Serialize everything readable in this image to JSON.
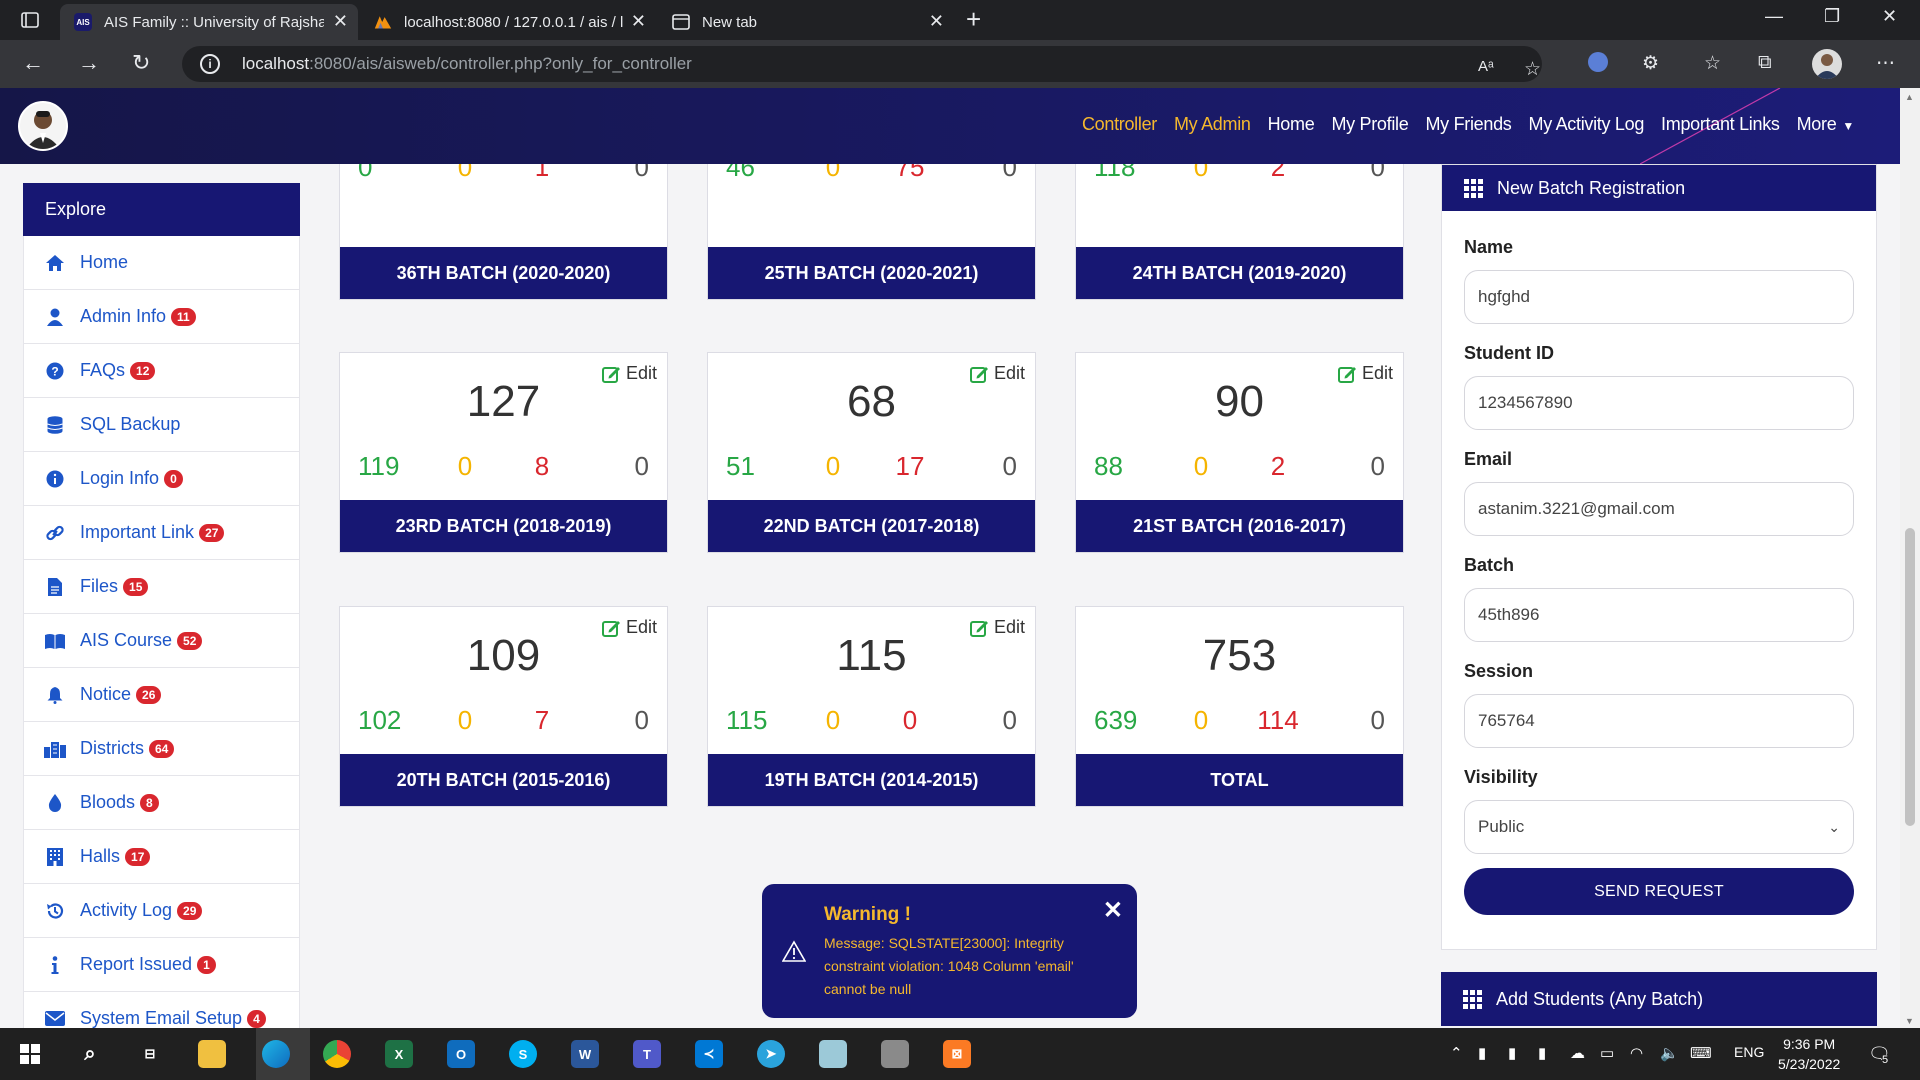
{
  "browser": {
    "tabs": [
      {
        "title": "AIS Family :: University of Rajshah",
        "favicon": "AIS",
        "active": true
      },
      {
        "title": "localhost:8080 / 127.0.0.1 / ais / l",
        "favicon": "pma",
        "active": false
      },
      {
        "title": "New tab",
        "favicon": "new-tab",
        "active": false
      }
    ],
    "url_host": "localhost",
    "url_rest": ":8080/ais/aisweb/controller.php?only_for_controller",
    "read_aloud": "Aᵃ"
  },
  "navbar": {
    "links": [
      "Controller",
      "My Admin",
      "Home",
      "My Profile",
      "My Friends",
      "My Activity Log",
      "Important Links",
      "More"
    ],
    "highlight_color": "#f5b82e",
    "background": "#171773"
  },
  "sidebar": {
    "title": "Explore",
    "items": [
      {
        "label": "Home",
        "icon": "home-icon",
        "badge": ""
      },
      {
        "label": "Admin Info",
        "icon": "user-icon",
        "badge": "11"
      },
      {
        "label": "FAQs",
        "icon": "question-circle-icon",
        "badge": "12"
      },
      {
        "label": "SQL Backup",
        "icon": "database-icon",
        "badge": ""
      },
      {
        "label": "Login Info",
        "icon": "info-circle-icon",
        "badge": "0"
      },
      {
        "label": "Important Link",
        "icon": "link-icon",
        "badge": "27"
      },
      {
        "label": "Files",
        "icon": "file-icon",
        "badge": "15"
      },
      {
        "label": "AIS Course",
        "icon": "book-open-icon",
        "badge": "52"
      },
      {
        "label": "Notice",
        "icon": "bell-icon",
        "badge": "26"
      },
      {
        "label": "Districts",
        "icon": "city-icon",
        "badge": "64"
      },
      {
        "label": "Bloods",
        "icon": "tint-icon",
        "badge": "8"
      },
      {
        "label": "Halls",
        "icon": "building-icon",
        "badge": "17"
      },
      {
        "label": "Activity Log",
        "icon": "history-icon",
        "badge": "29"
      },
      {
        "label": "Report Issued",
        "icon": "info-icon",
        "badge": "1"
      },
      {
        "label": "System Email Setup",
        "icon": "envelope-icon",
        "badge": "4"
      }
    ]
  },
  "batches": {
    "edit_label": "Edit",
    "cards": [
      {
        "name": "36TH BATCH (2020-2020)",
        "total": "",
        "stats": [
          "0",
          "0",
          "1",
          "0"
        ],
        "editable": false
      },
      {
        "name": "25TH BATCH (2020-2021)",
        "total": "",
        "stats": [
          "46",
          "0",
          "75",
          "0"
        ],
        "editable": false
      },
      {
        "name": "24TH BATCH (2019-2020)",
        "total": "",
        "stats": [
          "118",
          "0",
          "2",
          "0"
        ],
        "editable": false
      },
      {
        "name": "23RD BATCH (2018-2019)",
        "total": "127",
        "stats": [
          "119",
          "0",
          "8",
          "0"
        ],
        "editable": true
      },
      {
        "name": "22ND BATCH (2017-2018)",
        "total": "68",
        "stats": [
          "51",
          "0",
          "17",
          "0"
        ],
        "editable": true
      },
      {
        "name": "21ST BATCH (2016-2017)",
        "total": "90",
        "stats": [
          "88",
          "0",
          "2",
          "0"
        ],
        "editable": true
      },
      {
        "name": "20TH BATCH (2015-2016)",
        "total": "109",
        "stats": [
          "102",
          "0",
          "7",
          "0"
        ],
        "editable": true
      },
      {
        "name": "19TH BATCH (2014-2015)",
        "total": "115",
        "stats": [
          "115",
          "0",
          "0",
          "0"
        ],
        "editable": true
      },
      {
        "name": "TOTAL",
        "total": "753",
        "stats": [
          "639",
          "0",
          "114",
          "0"
        ],
        "editable": false
      }
    ],
    "stat_colors": [
      "#28a745",
      "#f5b400",
      "#d9272e",
      "#555555"
    ]
  },
  "new_batch_form": {
    "title": "New Batch Registration",
    "fields": [
      {
        "label": "Name",
        "value": "hgfghd"
      },
      {
        "label": "Student ID",
        "value": "1234567890"
      },
      {
        "label": "Email",
        "value": "astanim.3221@gmail.com"
      },
      {
        "label": "Batch",
        "value": "45th896"
      },
      {
        "label": "Session",
        "value": "765764"
      }
    ],
    "visibility_label": "Visibility",
    "visibility_value": "Public",
    "submit_label": "SEND REQUEST"
  },
  "add_students": {
    "title": "Add Students (Any Batch)"
  },
  "toast": {
    "title": "Warning !",
    "message": "Message: SQLSTATE[23000]: Integrity constraint violation: 1048 Column 'email' cannot be null"
  },
  "taskbar": {
    "language": "ENG",
    "time": "9:36 PM",
    "date": "5/23/2022",
    "notifications": "5"
  }
}
